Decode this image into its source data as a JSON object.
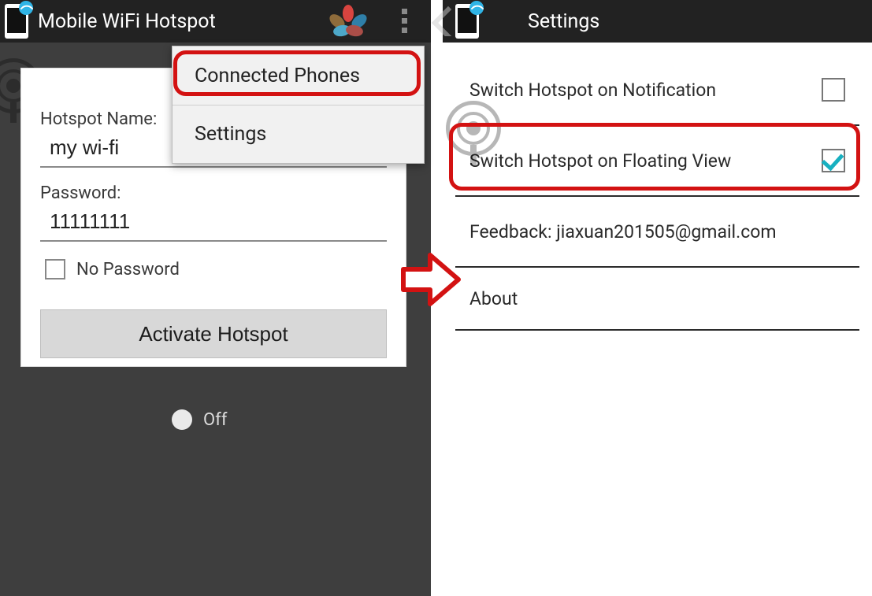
{
  "left": {
    "app_title": "Mobile WiFi Hotspot",
    "menu": {
      "items": [
        "Connected Phones",
        "Settings"
      ]
    },
    "card": {
      "name_label": "Hotspot Name:",
      "name_value": "my wi-fi",
      "password_label": "Password:",
      "password_value": "11111111",
      "no_password_label": "No Password",
      "activate_label": "Activate Hotspot"
    },
    "toggle": {
      "state_label": "Off"
    }
  },
  "right": {
    "title": "Settings",
    "rows": {
      "notification": {
        "label": "Switch Hotspot on Notification",
        "checked": false
      },
      "floating": {
        "label": "Switch Hotspot on Floating View",
        "checked": true
      },
      "feedback": {
        "label": "Feedback: jiaxuan201505@gmail.com"
      },
      "about": {
        "label": "About"
      }
    }
  }
}
